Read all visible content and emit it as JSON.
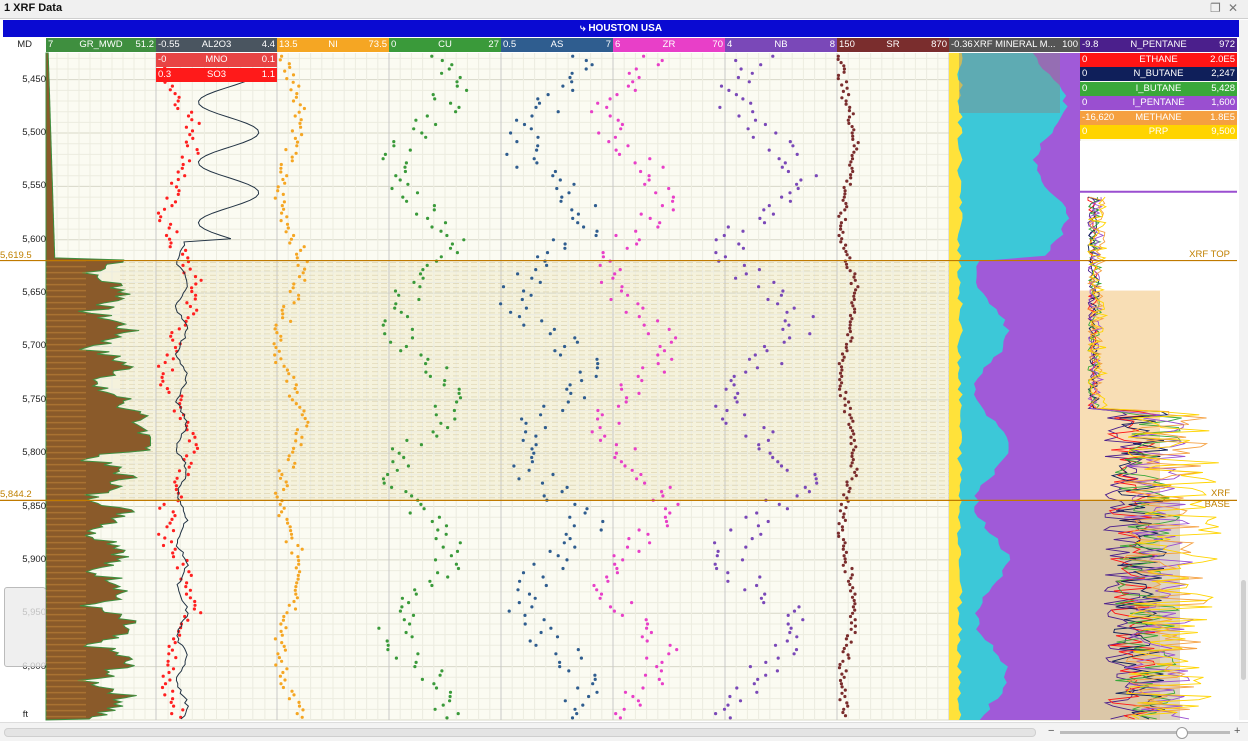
{
  "window": {
    "title": "1 XRF Data"
  },
  "well": {
    "name": "HOUSTON USA"
  },
  "depth": {
    "label": "MD",
    "unit": "ft",
    "range": [
      5425,
      6050
    ],
    "ticks": [
      "5,450",
      "5,500",
      "5,550",
      "5,600",
      "5,650",
      "5,700",
      "5,750",
      "5,800",
      "5,850",
      "5,900",
      "5,950",
      "6,000"
    ]
  },
  "tracks": [
    {
      "name": "GR_MWD",
      "min": "7",
      "max": "51.2",
      "color": "#3f8f3f"
    },
    {
      "name": "AL2O3",
      "min": "-0.55",
      "max": "4.4",
      "color": "#4a5560"
    },
    {
      "name": "NI",
      "min": "13.5",
      "max": "73.5",
      "color": "#f5a623"
    },
    {
      "name": "CU",
      "min": "0",
      "max": "27",
      "color": "#3a9a3a"
    },
    {
      "name": "AS",
      "min": "0.5",
      "max": "7",
      "color": "#2f5d8f"
    },
    {
      "name": "ZR",
      "min": "6",
      "max": "70",
      "color": "#e83fc8"
    },
    {
      "name": "NB",
      "min": "4",
      "max": "8",
      "color": "#7a48b8"
    },
    {
      "name": "SR",
      "min": "150",
      "max": "870",
      "color": "#7a2d2d"
    },
    {
      "name": "XRF MINERAL M...",
      "min": "-0.36",
      "max": "100",
      "color": "#555555"
    }
  ],
  "sub_curves": [
    {
      "name": "MNO",
      "min": "-0",
      "max": "0.1",
      "color": "#e84444"
    },
    {
      "name": "SO3",
      "min": "0.3",
      "max": "1.1",
      "color": "#ff1a1a"
    }
  ],
  "gas_curves": [
    {
      "name": "N_PENTANE",
      "min": "-9.8",
      "max": "972",
      "color": "#4b1f8c"
    },
    {
      "name": "ETHANE",
      "min": "0",
      "max": "2.0E5",
      "color": "#ff1414"
    },
    {
      "name": "N_BUTANE",
      "min": "0",
      "max": "2,247",
      "color": "#0f1f5a"
    },
    {
      "name": "I_BUTANE",
      "min": "0",
      "max": "5,428",
      "color": "#3aa83a"
    },
    {
      "name": "I_PENTANE",
      "min": "0",
      "max": "1,600",
      "color": "#9a4fd0"
    },
    {
      "name": "METHANE",
      "min": "-16,620",
      "max": "1.8E5",
      "color": "#f5a040"
    },
    {
      "name": "PRP",
      "min": "0",
      "max": "9,500",
      "color": "#ffd400"
    }
  ],
  "formations": [
    {
      "name": "XRF TOP",
      "depth": 5619.5,
      "depth_label": "5,619.5"
    },
    {
      "name": "XRF BASE",
      "depth": 5844.2,
      "depth_label": "5,844.2"
    }
  ],
  "colors": {
    "well_bar": "#0a0ad2",
    "formation_line": "#c07a00",
    "mineral_cyan": "#3cc8d8",
    "mineral_purple": "#a05ad8"
  }
}
